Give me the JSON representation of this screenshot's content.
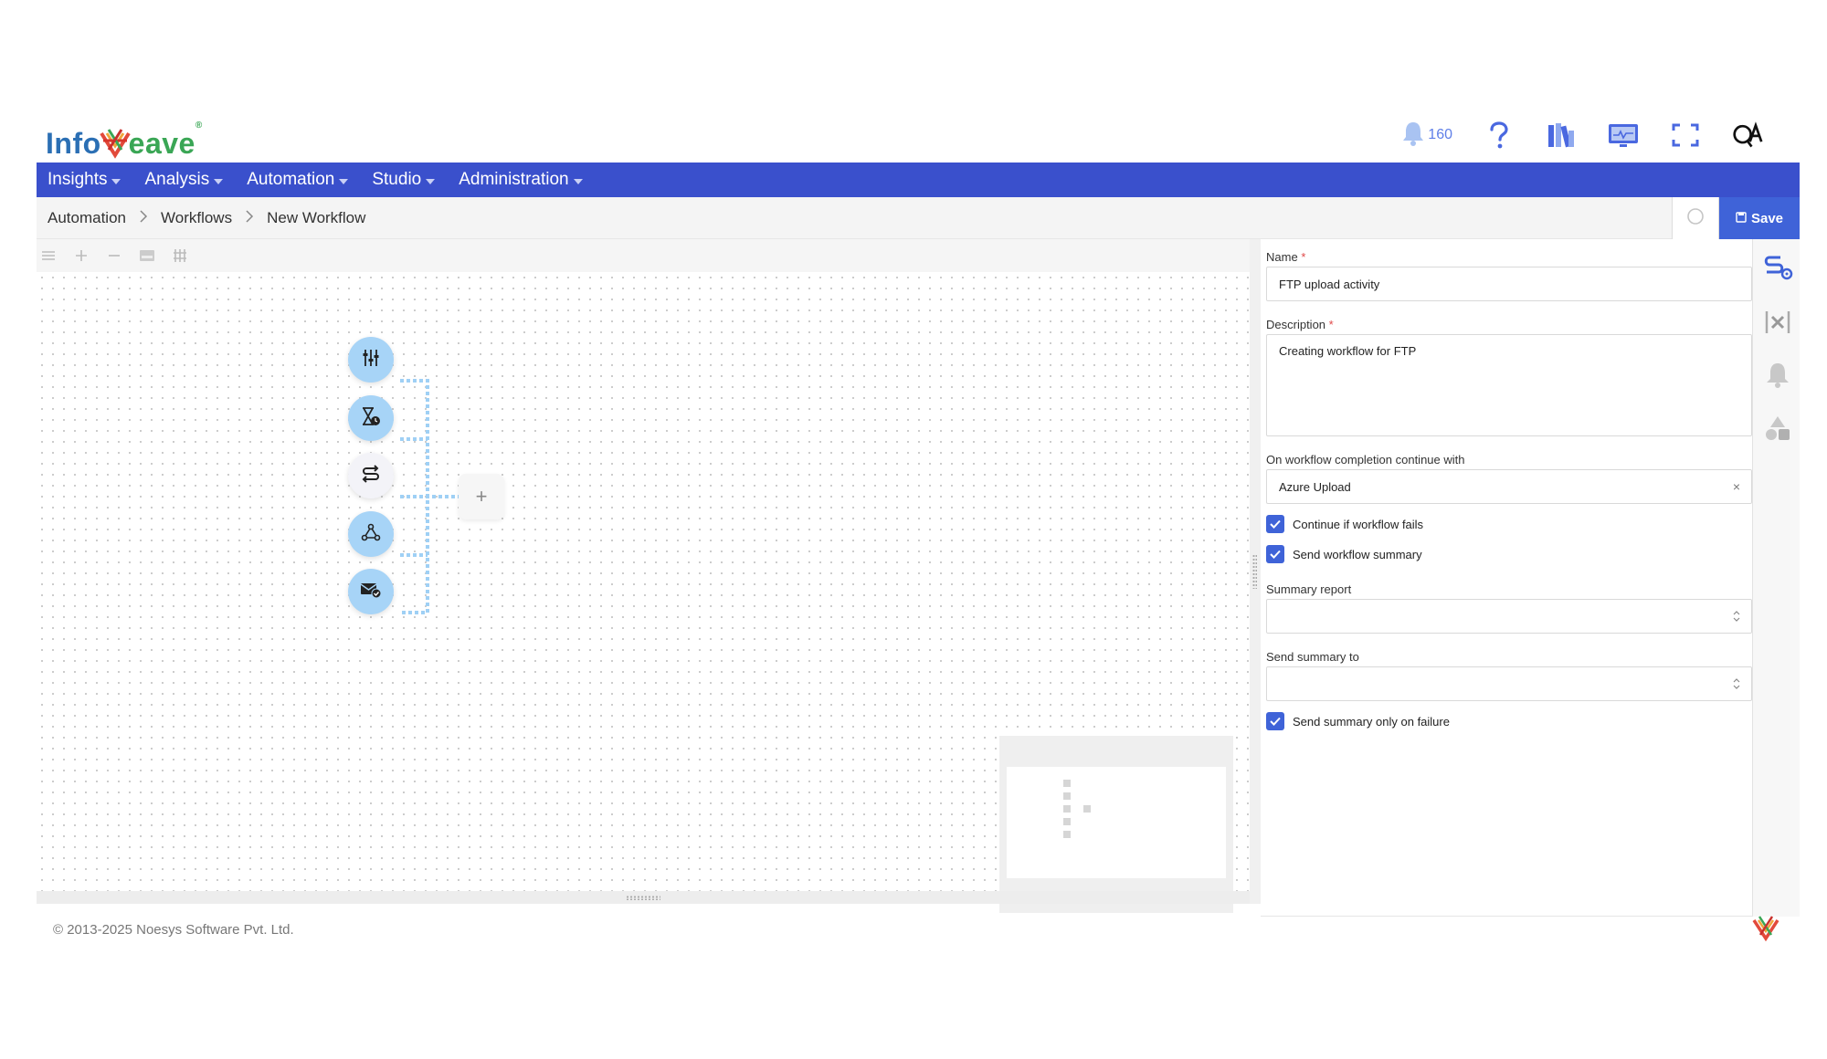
{
  "header": {
    "logo_left": "Info",
    "logo_right": "eave",
    "logo_reg": "®",
    "notification_count": "160",
    "icons": [
      "bell-icon",
      "help-icon",
      "library-icon",
      "monitor-icon",
      "fullscreen-icon",
      "user-initials-icon"
    ],
    "user_initials": "QA"
  },
  "nav": {
    "items": [
      {
        "label": "Insights"
      },
      {
        "label": "Analysis"
      },
      {
        "label": "Automation"
      },
      {
        "label": "Studio"
      },
      {
        "label": "Administration"
      }
    ]
  },
  "breadcrumb": {
    "items": [
      "Automation",
      "Workflows",
      "New Workflow"
    ]
  },
  "toolbar": {
    "save_label": "Save"
  },
  "canvas": {
    "nodes": [
      {
        "icon": "sliders-icon"
      },
      {
        "icon": "hourglass-clock-icon"
      },
      {
        "icon": "route-icon"
      },
      {
        "icon": "webhook-icon"
      },
      {
        "icon": "mail-check-icon"
      }
    ],
    "add_symbol": "+"
  },
  "form": {
    "name_label": "Name",
    "name_value": "FTP upload activity",
    "description_label": "Description",
    "description_value": "Creating workflow for FTP",
    "required_mark": "*",
    "completion_label": "On workflow completion continue with",
    "completion_value": "Azure Upload",
    "clear_symbol": "×",
    "continue_fail_label": "Continue if workflow fails",
    "continue_fail_checked": true,
    "send_summary_label": "Send workflow summary",
    "send_summary_checked": true,
    "summary_report_label": "Summary report",
    "summary_report_value": "",
    "send_to_label": "Send summary to",
    "send_to_value": "",
    "failure_only_label": "Send summary only on failure",
    "failure_only_checked": true
  },
  "rail": {
    "icons": [
      "workflow-settings-icon",
      "variables-icon",
      "notification-icon",
      "shapes-icon"
    ]
  },
  "footer": {
    "copyright": "© 2013-2025 Noesys Software Pvt. Ltd."
  },
  "colors": {
    "brand_blue": "#3a50cc",
    "accent": "#3f63d8",
    "node_blue": "#a7d4f7",
    "connector": "#9fd0f5"
  }
}
